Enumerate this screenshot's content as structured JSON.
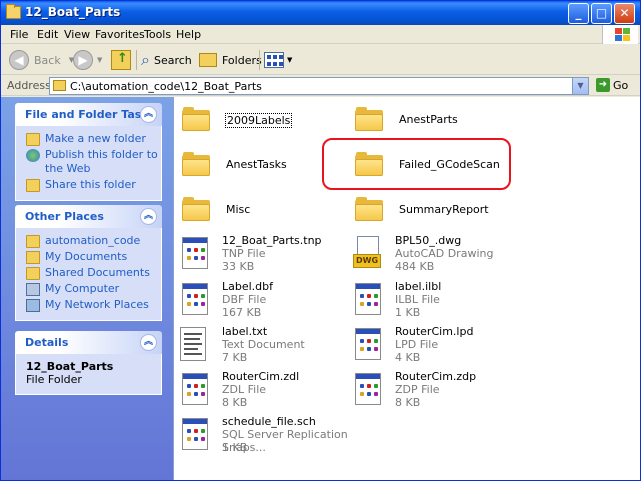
{
  "window": {
    "title": "12_Boat_Parts",
    "min": "_",
    "max": "□",
    "close": "✕"
  },
  "menu": [
    "File",
    "Edit",
    "View",
    "Favorites",
    "Tools",
    "Help"
  ],
  "toolbar": {
    "back": "Back",
    "search": "Search",
    "folders": "Folders"
  },
  "address": {
    "label": "Address",
    "path": "C:\\automation_code\\12_Boat_Parts",
    "go": "Go"
  },
  "tasks": {
    "file_folder": {
      "title": "File and Folder Tasks",
      "items": [
        "Make a new folder",
        "Publish this folder to the Web",
        "Share this folder"
      ]
    },
    "other_places": {
      "title": "Other Places",
      "items": [
        "automation_code",
        "My Documents",
        "Shared Documents",
        "My Computer",
        "My Network Places"
      ]
    },
    "details": {
      "title": "Details",
      "name": "12_Boat_Parts",
      "type": "File Folder"
    }
  },
  "files": [
    {
      "name": "2009Labels",
      "kind": "folder"
    },
    {
      "name": "AnestParts",
      "kind": "folder"
    },
    {
      "name": "AnestTasks",
      "kind": "folder"
    },
    {
      "name": "Failed_GCodeScan",
      "kind": "folder"
    },
    {
      "name": "Misc",
      "kind": "folder"
    },
    {
      "name": "SummaryReport",
      "kind": "folder"
    },
    {
      "name": "12_Boat_Parts.tnp",
      "type": "TNP File",
      "size": "33 KB",
      "kind": "doc"
    },
    {
      "name": "BPL50_.dwg",
      "type": "AutoCAD Drawing",
      "size": "484 KB",
      "kind": "dwg"
    },
    {
      "name": "Label.dbf",
      "type": "DBF File",
      "size": "167 KB",
      "kind": "doc"
    },
    {
      "name": "label.ilbl",
      "type": "ILBL File",
      "size": "1 KB",
      "kind": "doc"
    },
    {
      "name": "label.txt",
      "type": "Text Document",
      "size": "7 KB",
      "kind": "txt"
    },
    {
      "name": "RouterCim.lpd",
      "type": "LPD File",
      "size": "4 KB",
      "kind": "doc"
    },
    {
      "name": "RouterCim.zdl",
      "type": "ZDL File",
      "size": "8 KB",
      "kind": "doc"
    },
    {
      "name": "RouterCim.zdp",
      "type": "ZDP File",
      "size": "8 KB",
      "kind": "doc"
    },
    {
      "name": "schedule_file.sch",
      "type": "SQL Server Replication Snaps...",
      "size": "1 KB",
      "kind": "doc"
    }
  ]
}
